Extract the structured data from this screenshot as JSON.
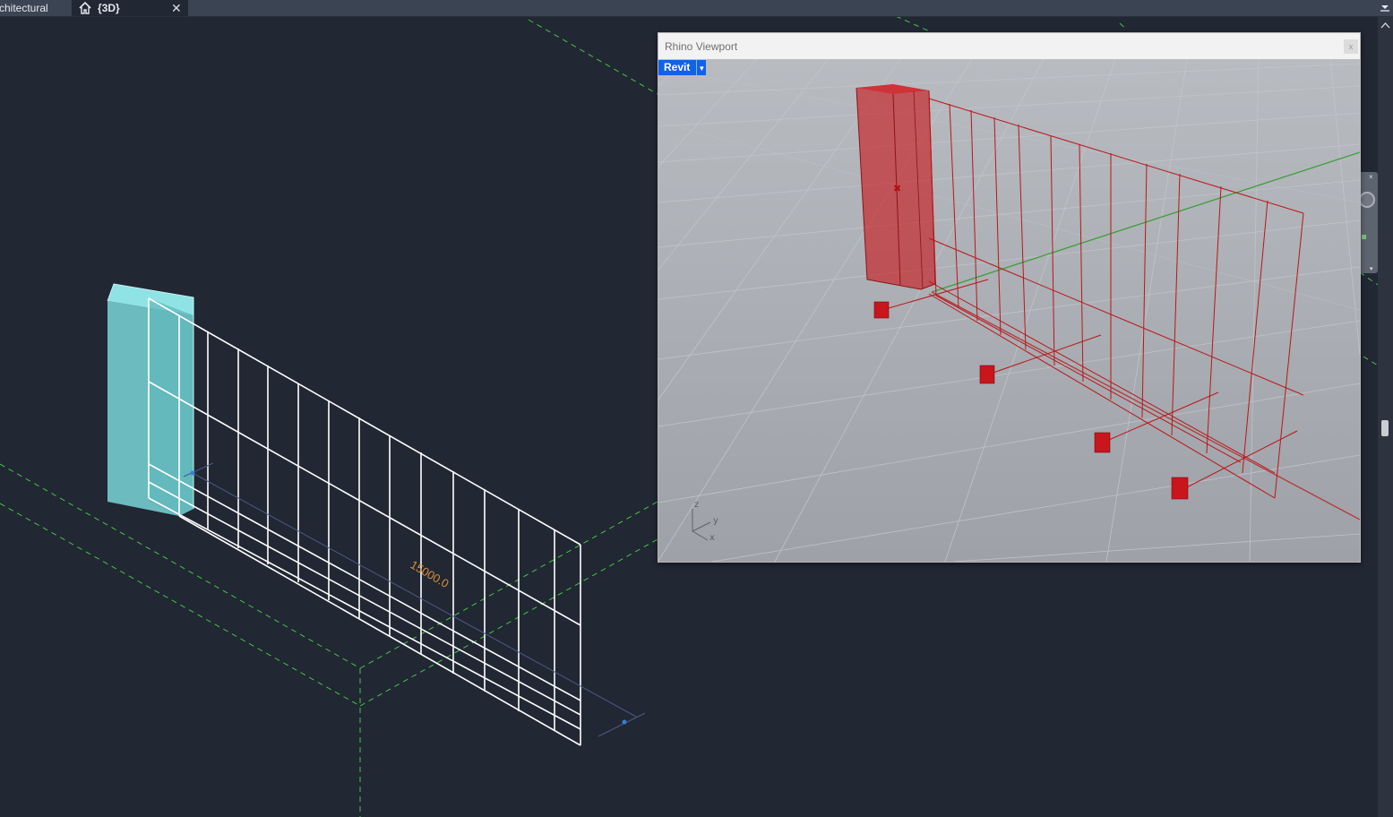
{
  "tabs": [
    {
      "label": "rchitectural",
      "active": false
    },
    {
      "label": "{3D}",
      "active": true,
      "icon": "home-icon",
      "close_glyph": "✕"
    }
  ],
  "main_view": {
    "dimension_label": "15000.0",
    "colors": {
      "background": "#212733",
      "wireframe": "#ffffff",
      "column_fill": "#79d6d8",
      "grid_lines": "#47c446",
      "dimension_text": "#d58f3a"
    }
  },
  "rhino_viewport": {
    "title": "Rhino Viewport",
    "close_glyph": "x",
    "view_menu_label": "Revit",
    "axis_labels": {
      "z": "z",
      "y": "y",
      "x": "x"
    },
    "colors": {
      "background": "#a4a7ac",
      "geometry": "#c8161c",
      "y_axis": "#3e9e3a",
      "x_axis": "#b43a3a",
      "accent": "#1261e8"
    }
  }
}
